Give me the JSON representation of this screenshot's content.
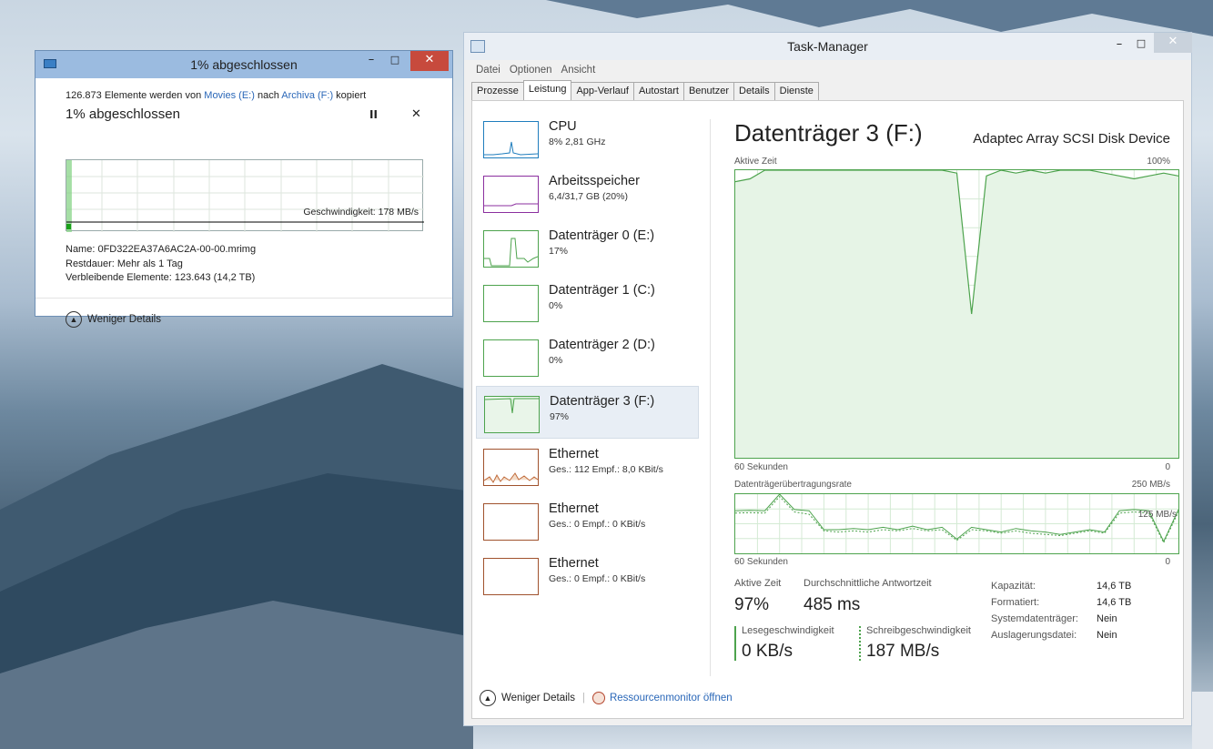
{
  "copy_dialog": {
    "title": "1% abgeschlossen",
    "line_count": "126.873 Elemente werden von ",
    "source": "Movies (E:)",
    "line_mid": " nach ",
    "dest": "Archiva (F:)",
    "line_end": " kopiert",
    "progress_text": "1% abgeschlossen",
    "progress_fraction": 0.01,
    "speed": "Geschwindigkeit: 178 MB/s",
    "name": "Name:  0FD322EA37A6AC2A-00-00.mrimg",
    "remaining_time": "Restdauer:  Mehr als 1 Tag",
    "remaining_items": "Verbleibende Elemente:  123.643 (14,2 TB)",
    "fewer_details": "Weniger Details",
    "minimize": "–",
    "maximize": "□",
    "close": "✕",
    "pause": "II",
    "cancel": "✕"
  },
  "task_manager": {
    "title": "Task-Manager",
    "minimize": "–",
    "maximize": "□",
    "close": "✕",
    "menu": [
      "Datei",
      "Optionen",
      "Ansicht"
    ],
    "tabs": [
      "Prozesse",
      "Leistung",
      "App-Verlauf",
      "Autostart",
      "Benutzer",
      "Details",
      "Dienste"
    ],
    "active_tab": "Leistung",
    "sidebar": [
      {
        "name": "CPU",
        "sub": "8% 2,81 GHz",
        "color": "#1f7dbd"
      },
      {
        "name": "Arbeitsspeicher",
        "sub": "6,4/31,7 GB (20%)",
        "color": "#8b2f9f"
      },
      {
        "name": "Datenträger 0 (E:)",
        "sub": "17%",
        "color": "#4da34d"
      },
      {
        "name": "Datenträger 1 (C:)",
        "sub": "0%",
        "color": "#4da34d"
      },
      {
        "name": "Datenträger 2 (D:)",
        "sub": "0%",
        "color": "#4da34d"
      },
      {
        "name": "Datenträger 3 (F:)",
        "sub": "97%",
        "color": "#4da34d"
      },
      {
        "name": "Ethernet",
        "sub": "Ges.: 112 Empf.: 8,0 KBit/s",
        "color": "#a0522d"
      },
      {
        "name": "Ethernet",
        "sub": "Ges.: 0 Empf.: 0 KBit/s",
        "color": "#a0522d"
      },
      {
        "name": "Ethernet",
        "sub": "Ges.: 0 Empf.: 0 KBit/s",
        "color": "#a0522d"
      }
    ],
    "main": {
      "heading": "Datenträger 3 (F:)",
      "device": "Adaptec Array SCSI Disk Device",
      "active_time_label": "Aktive Zeit",
      "active_max": "100%",
      "seconds_label": "60 Sekunden",
      "zero": "0",
      "transfer_label": "Datenträgerübertragungsrate",
      "transfer_max": "250 MB/s",
      "transfer_mid": "125 MB/s",
      "stats": {
        "active_time_label": "Aktive Zeit",
        "active_time_value": "97%",
        "avg_resp_label": "Durchschnittliche Antwortzeit",
        "avg_resp_value": "485 ms",
        "read_label": "Lesegeschwindigkeit",
        "read_value": "0 KB/s",
        "write_label": "Schreibgeschwindigkeit",
        "write_value": "187 MB/s"
      },
      "props": [
        {
          "k": "Kapazität:",
          "v": "14,6 TB"
        },
        {
          "k": "Formatiert:",
          "v": "14,6 TB"
        },
        {
          "k": "Systemdatenträger:",
          "v": "Nein"
        },
        {
          "k": "Auslagerungsdatei:",
          "v": "Nein"
        }
      ]
    },
    "fewer_details": "Weniger Details",
    "resource_monitor": "Ressourcenmonitor öffnen"
  },
  "chart_data": [
    {
      "type": "area",
      "title": "Aktive Zeit",
      "ylim": [
        0,
        100
      ],
      "x": [
        60,
        58,
        56,
        54,
        52,
        50,
        48,
        46,
        44,
        42,
        40,
        38,
        36,
        34,
        32,
        30,
        28,
        26,
        24,
        22,
        20,
        18,
        16,
        14,
        12,
        10,
        8,
        6,
        4,
        2,
        0
      ],
      "values": [
        96,
        97,
        100,
        100,
        100,
        100,
        100,
        100,
        100,
        100,
        100,
        100,
        100,
        100,
        100,
        99,
        50,
        98,
        100,
        99,
        100,
        99,
        100,
        100,
        100,
        99,
        98,
        97,
        98,
        99,
        98
      ],
      "color": "#4da34d"
    },
    {
      "type": "line",
      "title": "Datenträgerübertragungsrate",
      "ylim": [
        0,
        250
      ],
      "x": [
        60,
        58,
        56,
        54,
        52,
        50,
        48,
        46,
        44,
        42,
        40,
        38,
        36,
        34,
        32,
        30,
        28,
        26,
        24,
        22,
        20,
        18,
        16,
        14,
        12,
        10,
        8,
        6,
        4,
        2,
        0
      ],
      "series": [
        {
          "values": [
            180,
            182,
            180,
            250,
            185,
            180,
            100,
            100,
            105,
            100,
            110,
            100,
            115,
            100,
            110,
            60,
            110,
            100,
            90,
            105,
            95,
            90,
            80,
            90,
            100,
            90,
            180,
            185,
            180,
            50,
            185
          ]
        },
        {
          "values": [
            170,
            172,
            170,
            240,
            175,
            165,
            95,
            90,
            95,
            90,
            100,
            95,
            105,
            95,
            100,
            55,
            100,
            95,
            85,
            95,
            85,
            80,
            75,
            85,
            95,
            85,
            170,
            175,
            170,
            45,
            175
          ]
        }
      ],
      "color": "#4da34d"
    }
  ]
}
